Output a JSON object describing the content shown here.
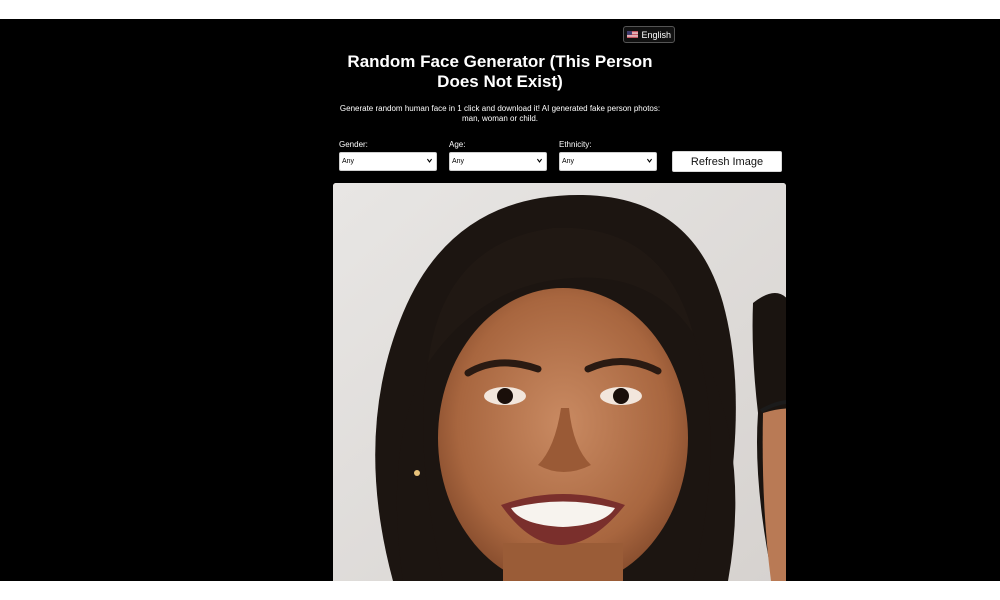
{
  "header": {
    "language_label": "English",
    "language_flag_icon": "us-flag-icon",
    "title": "Random Face Generator (This Person Does Not Exist)",
    "subtitle": "Generate random human face in 1 click and download it! AI generated fake person photos: man, woman or child."
  },
  "filters": {
    "gender": {
      "label": "Gender:",
      "value": "Any"
    },
    "age": {
      "label": "Age:",
      "value": "Any"
    },
    "ethnicity": {
      "label": "Ethnicity:",
      "value": "Any"
    }
  },
  "actions": {
    "refresh_label": "Refresh Image"
  },
  "colors": {
    "page_background": "#000000",
    "text": "#ffffff",
    "button_background": "#ffffff"
  }
}
